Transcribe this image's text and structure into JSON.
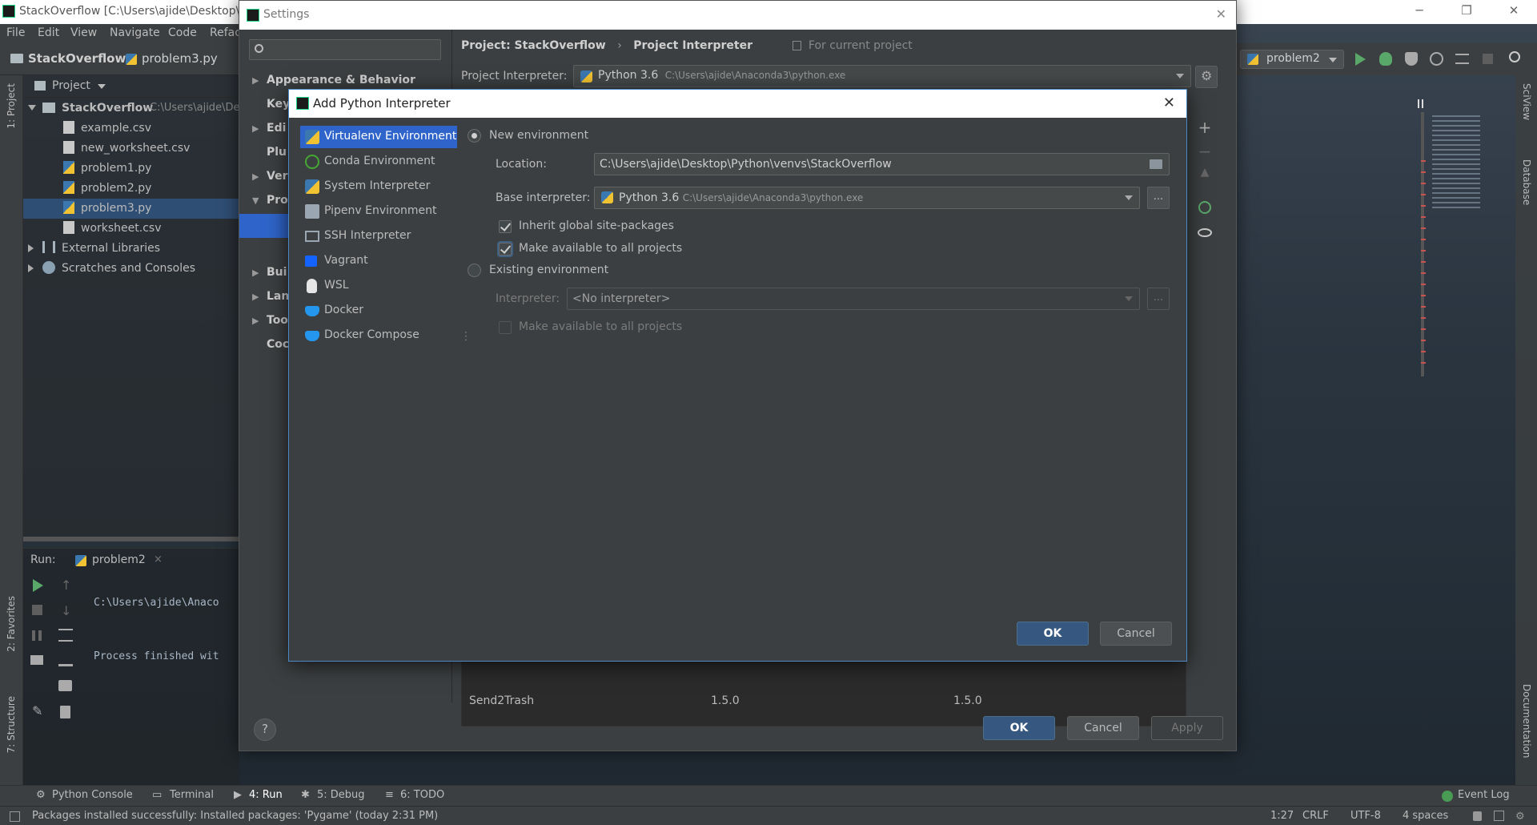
{
  "ide": {
    "title": "StackOverflow [C:\\Users\\ajide\\Desktop\\Py",
    "menu": [
      "File",
      "Edit",
      "View",
      "Navigate",
      "Code",
      "Refac"
    ],
    "nav_project": "StackOverflow",
    "nav_file": "problem3.py",
    "run_config": "problem2",
    "left_tabs": [
      "1: Project",
      "2: Favorites",
      "7: Structure"
    ],
    "right_tabs": [
      "SciView",
      "Database",
      "Documentation"
    ]
  },
  "project_panel": {
    "header": "Project",
    "root": "StackOverflow",
    "root_path": "C:\\Users\\ajide\\De",
    "files": [
      "example.csv",
      "new_worksheet.csv",
      "problem1.py",
      "problem2.py",
      "problem3.py",
      "worksheet.csv"
    ],
    "selected_file": "problem3.py",
    "external": "External Libraries",
    "scratches": "Scratches and Consoles"
  },
  "run_panel": {
    "label": "Run:",
    "tab": "problem2",
    "line1": "C:\\Users\\ajide\\Anaco",
    "line2": "Process finished wit"
  },
  "bottom_tabs": [
    "Python Console",
    "Terminal",
    "4: Run",
    "5: Debug",
    "6: TODO"
  ],
  "event_log": "Event Log",
  "status": {
    "message": "Packages installed successfully: Installed packages: 'Pygame' (today 2:31 PM)",
    "position": "1:27",
    "line_sep": "CRLF",
    "encoding": "UTF-8",
    "indent": "4 spaces"
  },
  "settings": {
    "title": "Settings",
    "search_placeholder": "",
    "tree": [
      {
        "label": "Appearance & Behavior",
        "arrow": "▶"
      },
      {
        "label": "Key",
        "arrow": ""
      },
      {
        "label": "Edi",
        "arrow": "▶"
      },
      {
        "label": "Plu",
        "arrow": ""
      },
      {
        "label": "Ver",
        "arrow": "▶"
      },
      {
        "label": "Pro",
        "arrow": "▼"
      },
      {
        "label": "Bui",
        "arrow": "▶"
      },
      {
        "label": "Lan",
        "arrow": "▶"
      },
      {
        "label": "Too",
        "arrow": "▶"
      },
      {
        "label": "Coc",
        "arrow": ""
      }
    ],
    "breadcrumb_project": "Project: StackOverflow",
    "breadcrumb_sep": "›",
    "breadcrumb_page": "Project Interpreter",
    "for_current": "For current project",
    "interpreter_label": "Project Interpreter:",
    "interpreter_value": "Python 3.6",
    "interpreter_path": "C:\\Users\\ajide\\Anaconda3\\python.exe",
    "package_row": {
      "name": "Send2Trash",
      "version": "1.5.0",
      "latest": "1.5.0"
    },
    "ok": "OK",
    "cancel": "Cancel",
    "apply": "Apply",
    "help": "?"
  },
  "add_interpreter": {
    "title": "Add Python Interpreter",
    "types": [
      {
        "label": "Virtualenv Environment",
        "icon": "virtualenv-icon"
      },
      {
        "label": "Conda Environment",
        "icon": "conda-icon"
      },
      {
        "label": "System Interpreter",
        "icon": "python-icon"
      },
      {
        "label": "Pipenv Environment",
        "icon": "pipenv-icon"
      },
      {
        "label": "SSH Interpreter",
        "icon": "ssh-icon"
      },
      {
        "label": "Vagrant",
        "icon": "vagrant-icon"
      },
      {
        "label": "WSL",
        "icon": "linux-icon"
      },
      {
        "label": "Docker",
        "icon": "docker-icon"
      },
      {
        "label": "Docker Compose",
        "icon": "docker-compose-icon"
      }
    ],
    "selected_type": "Virtualenv Environment",
    "new_env": "New environment",
    "location_label": "Location:",
    "location_value": "C:\\Users\\ajide\\Desktop\\Python\\venvs\\StackOverflow",
    "base_label": "Base interpreter:",
    "base_value": "Python 3.6",
    "base_path": "C:\\Users\\ajide\\Anaconda3\\python.exe",
    "inherit": "Inherit global site-packages",
    "inherit_checked": true,
    "make_available": "Make available to all projects",
    "make_available_checked": true,
    "existing_env": "Existing environment",
    "interp_label": "Interpreter:",
    "interp_value": "<No interpreter>",
    "make_available2": "Make available to all projects",
    "dots": "...",
    "ok": "OK",
    "cancel": "Cancel"
  },
  "colors": {
    "accent": "#365880",
    "selection": "#2f65ca",
    "dialog_bg": "#3c3f41",
    "focus_border": "#4a88c7"
  }
}
